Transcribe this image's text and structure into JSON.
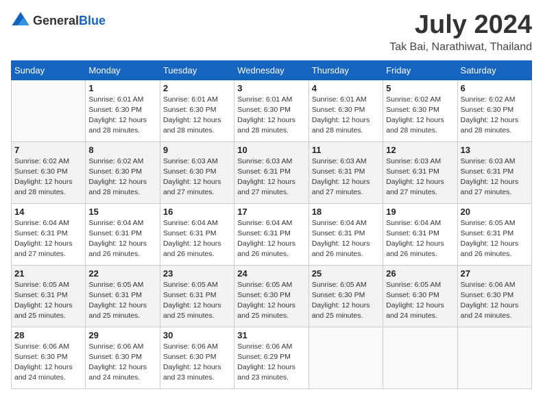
{
  "header": {
    "logo_general": "General",
    "logo_blue": "Blue",
    "month": "July 2024",
    "location": "Tak Bai, Narathiwat, Thailand"
  },
  "weekdays": [
    "Sunday",
    "Monday",
    "Tuesday",
    "Wednesday",
    "Thursday",
    "Friday",
    "Saturday"
  ],
  "weeks": [
    [
      {
        "day": "",
        "info": ""
      },
      {
        "day": "1",
        "info": "Sunrise: 6:01 AM\nSunset: 6:30 PM\nDaylight: 12 hours\nand 28 minutes."
      },
      {
        "day": "2",
        "info": "Sunrise: 6:01 AM\nSunset: 6:30 PM\nDaylight: 12 hours\nand 28 minutes."
      },
      {
        "day": "3",
        "info": "Sunrise: 6:01 AM\nSunset: 6:30 PM\nDaylight: 12 hours\nand 28 minutes."
      },
      {
        "day": "4",
        "info": "Sunrise: 6:01 AM\nSunset: 6:30 PM\nDaylight: 12 hours\nand 28 minutes."
      },
      {
        "day": "5",
        "info": "Sunrise: 6:02 AM\nSunset: 6:30 PM\nDaylight: 12 hours\nand 28 minutes."
      },
      {
        "day": "6",
        "info": "Sunrise: 6:02 AM\nSunset: 6:30 PM\nDaylight: 12 hours\nand 28 minutes."
      }
    ],
    [
      {
        "day": "7",
        "info": ""
      },
      {
        "day": "8",
        "info": "Sunrise: 6:02 AM\nSunset: 6:30 PM\nDaylight: 12 hours\nand 28 minutes."
      },
      {
        "day": "9",
        "info": "Sunrise: 6:03 AM\nSunset: 6:30 PM\nDaylight: 12 hours\nand 27 minutes."
      },
      {
        "day": "10",
        "info": "Sunrise: 6:03 AM\nSunset: 6:31 PM\nDaylight: 12 hours\nand 27 minutes."
      },
      {
        "day": "11",
        "info": "Sunrise: 6:03 AM\nSunset: 6:31 PM\nDaylight: 12 hours\nand 27 minutes."
      },
      {
        "day": "12",
        "info": "Sunrise: 6:03 AM\nSunset: 6:31 PM\nDaylight: 12 hours\nand 27 minutes."
      },
      {
        "day": "13",
        "info": "Sunrise: 6:03 AM\nSunset: 6:31 PM\nDaylight: 12 hours\nand 27 minutes."
      }
    ],
    [
      {
        "day": "14",
        "info": ""
      },
      {
        "day": "15",
        "info": "Sunrise: 6:04 AM\nSunset: 6:31 PM\nDaylight: 12 hours\nand 26 minutes."
      },
      {
        "day": "16",
        "info": "Sunrise: 6:04 AM\nSunset: 6:31 PM\nDaylight: 12 hours\nand 26 minutes."
      },
      {
        "day": "17",
        "info": "Sunrise: 6:04 AM\nSunset: 6:31 PM\nDaylight: 12 hours\nand 26 minutes."
      },
      {
        "day": "18",
        "info": "Sunrise: 6:04 AM\nSunset: 6:31 PM\nDaylight: 12 hours\nand 26 minutes."
      },
      {
        "day": "19",
        "info": "Sunrise: 6:04 AM\nSunset: 6:31 PM\nDaylight: 12 hours\nand 26 minutes."
      },
      {
        "day": "20",
        "info": "Sunrise: 6:05 AM\nSunset: 6:31 PM\nDaylight: 12 hours\nand 26 minutes."
      }
    ],
    [
      {
        "day": "21",
        "info": ""
      },
      {
        "day": "22",
        "info": "Sunrise: 6:05 AM\nSunset: 6:31 PM\nDaylight: 12 hours\nand 25 minutes."
      },
      {
        "day": "23",
        "info": "Sunrise: 6:05 AM\nSunset: 6:31 PM\nDaylight: 12 hours\nand 25 minutes."
      },
      {
        "day": "24",
        "info": "Sunrise: 6:05 AM\nSunset: 6:30 PM\nDaylight: 12 hours\nand 25 minutes."
      },
      {
        "day": "25",
        "info": "Sunrise: 6:05 AM\nSunset: 6:30 PM\nDaylight: 12 hours\nand 25 minutes."
      },
      {
        "day": "26",
        "info": "Sunrise: 6:05 AM\nSunset: 6:30 PM\nDaylight: 12 hours\nand 24 minutes."
      },
      {
        "day": "27",
        "info": "Sunrise: 6:06 AM\nSunset: 6:30 PM\nDaylight: 12 hours\nand 24 minutes."
      }
    ],
    [
      {
        "day": "28",
        "info": "Sunrise: 6:06 AM\nSunset: 6:30 PM\nDaylight: 12 hours\nand 24 minutes."
      },
      {
        "day": "29",
        "info": "Sunrise: 6:06 AM\nSunset: 6:30 PM\nDaylight: 12 hours\nand 24 minutes."
      },
      {
        "day": "30",
        "info": "Sunrise: 6:06 AM\nSunset: 6:30 PM\nDaylight: 12 hours\nand 23 minutes."
      },
      {
        "day": "31",
        "info": "Sunrise: 6:06 AM\nSunset: 6:29 PM\nDaylight: 12 hours\nand 23 minutes."
      },
      {
        "day": "",
        "info": ""
      },
      {
        "day": "",
        "info": ""
      },
      {
        "day": "",
        "info": ""
      }
    ]
  ],
  "week7_sunday_info": "Sunrise: 6:02 AM\nSunset: 6:30 PM\nDaylight: 12 hours\nand 28 minutes.",
  "week14_sunday_info": "Sunrise: 6:04 AM\nSunset: 6:31 PM\nDaylight: 12 hours\nand 27 minutes.",
  "week21_sunday_info": "Sunrise: 6:04 AM\nSunset: 6:31 PM\nDaylight: 12 hours\nand 26 minutes.",
  "week21_sunday2_info": "Sunrise: 6:05 AM\nSunset: 6:31 PM\nDaylight: 12 hours\nand 25 minutes."
}
